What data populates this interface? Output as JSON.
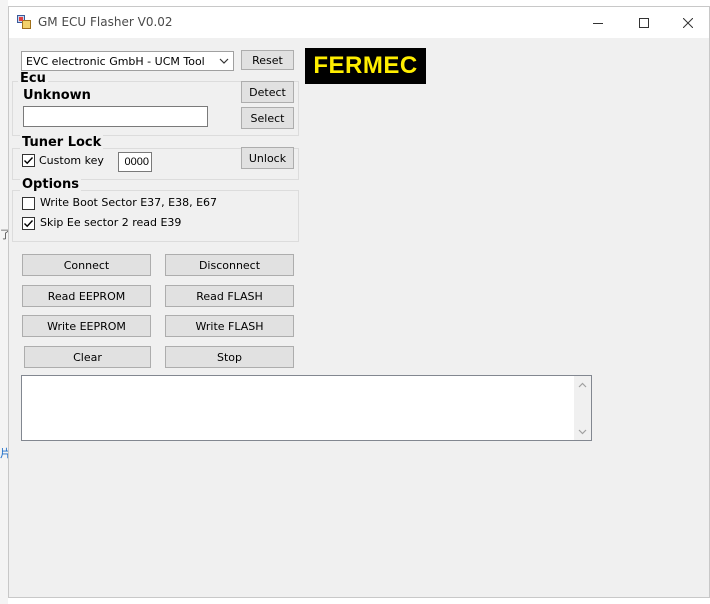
{
  "window": {
    "title": "GM ECU Flasher V0.02"
  },
  "edge_glyphs": [
    "了",
    "片"
  ],
  "tool_select": {
    "selected": "EVC electronic GmbH - UCM Tool",
    "reset_label": "Reset"
  },
  "logo_text": "FERMEC",
  "ecu": {
    "group_label": "Ecu",
    "status": "Unknown",
    "input_value": "",
    "detect_label": "Detect",
    "select_label": "Select"
  },
  "tuner_lock": {
    "group_label": "Tuner Lock",
    "custom_key_label": "Custom key",
    "custom_key_checked": true,
    "key_value": "0000",
    "unlock_label": "Unlock"
  },
  "options": {
    "group_label": "Options",
    "items": [
      {
        "label": "Write Boot Sector E37, E38, E67",
        "checked": false
      },
      {
        "label": "Skip Ee sector 2 read E39",
        "checked": true
      }
    ]
  },
  "actions": {
    "connect": "Connect",
    "disconnect": "Disconnect",
    "read_eeprom": "Read  EEPROM",
    "read_flash": "Read  FLASH",
    "write_eeprom": "Write  EEPROM",
    "write_flash": "Write  FLASH",
    "clear": "Clear",
    "stop": "Stop"
  },
  "log": {
    "text": ""
  }
}
